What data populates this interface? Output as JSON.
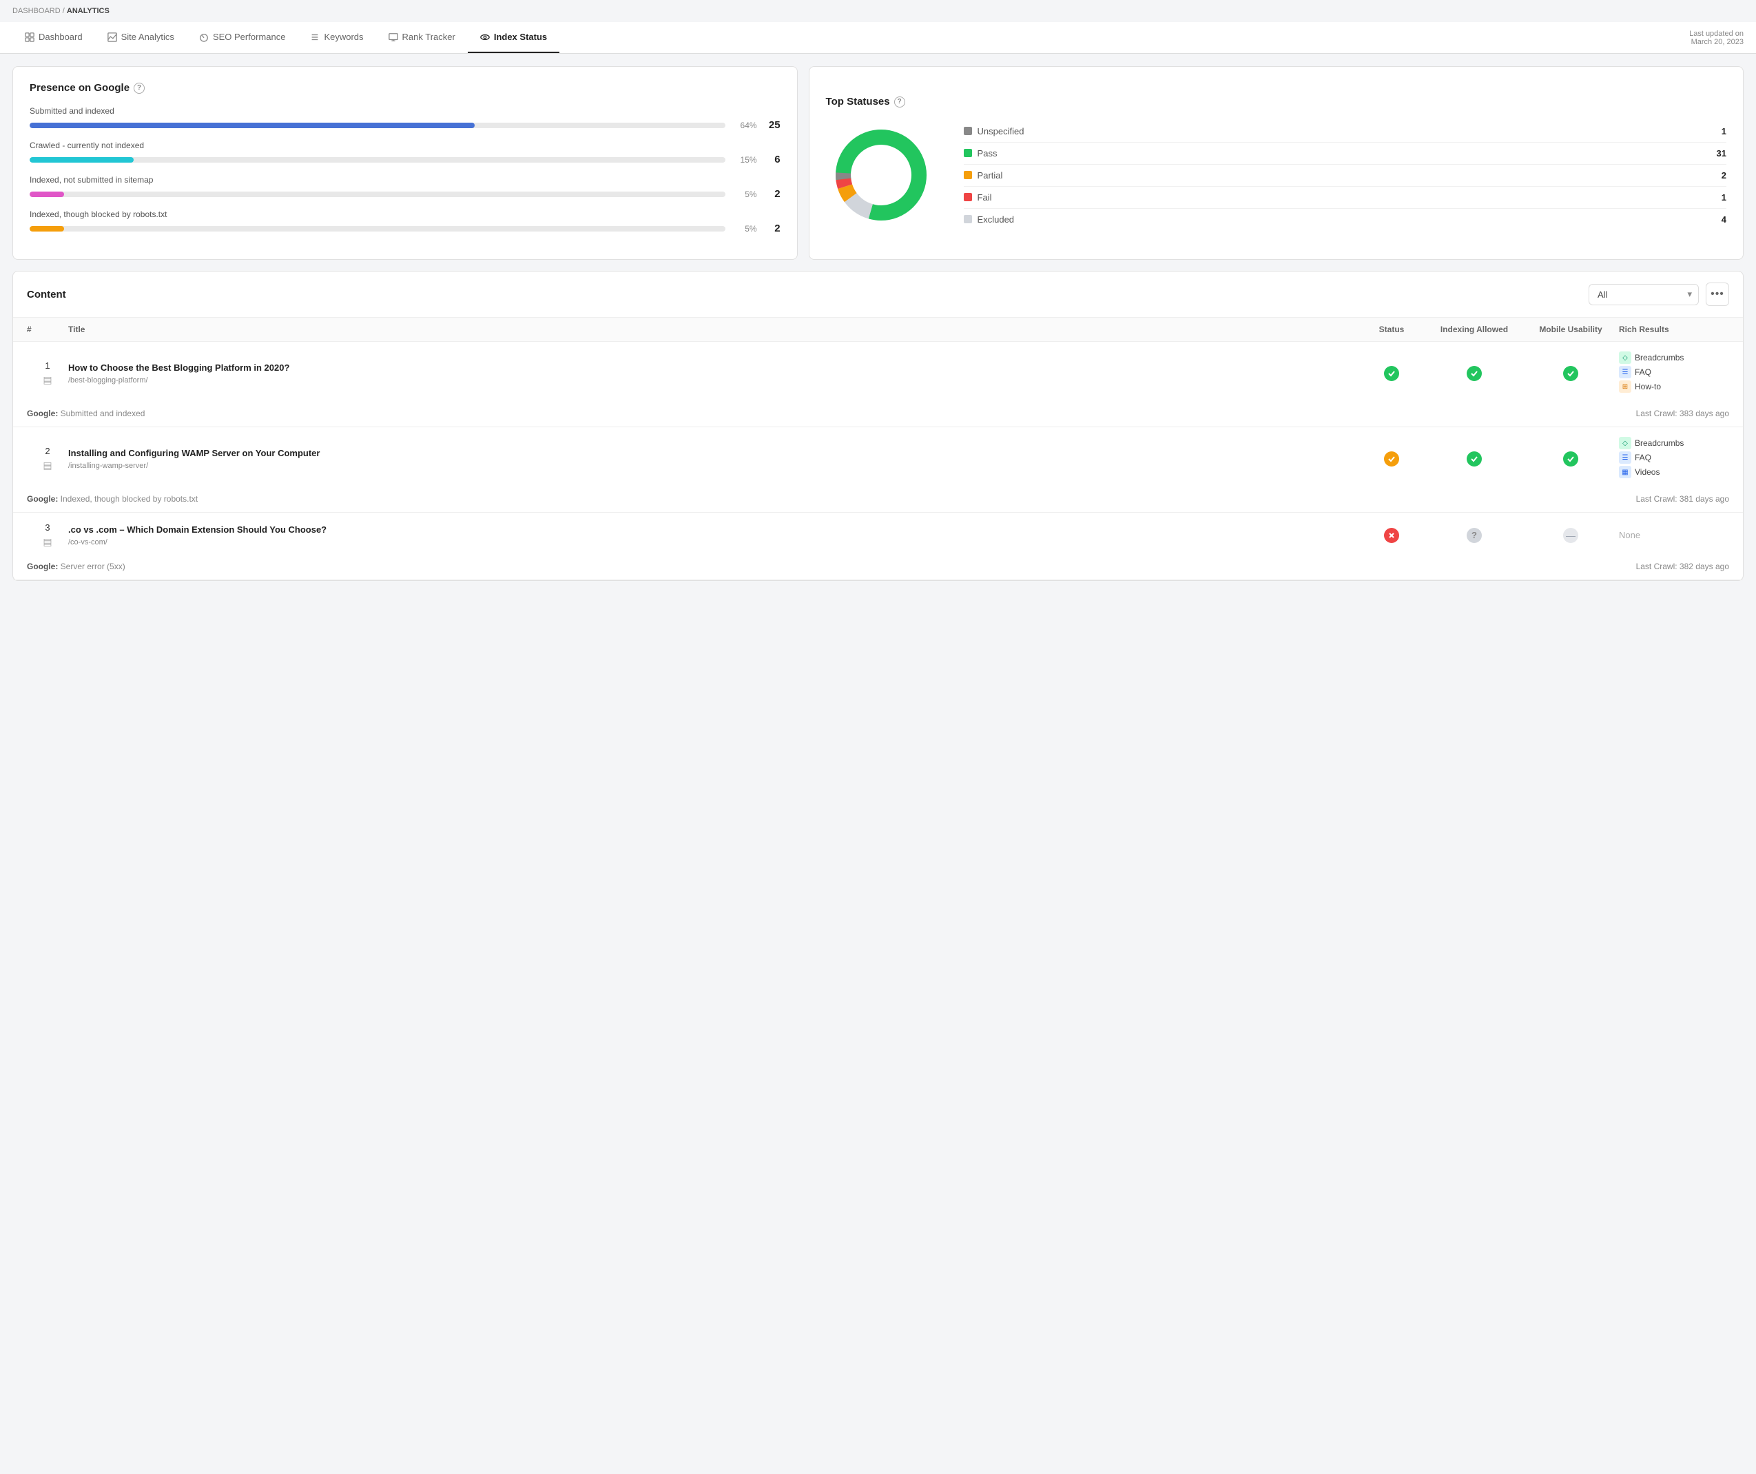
{
  "breadcrumb": {
    "dashboard": "DASHBOARD",
    "separator": "/",
    "current": "ANALYTICS"
  },
  "tabs": [
    {
      "id": "dashboard",
      "label": "Dashboard",
      "icon": "grid"
    },
    {
      "id": "site-analytics",
      "label": "Site Analytics",
      "icon": "chart"
    },
    {
      "id": "seo-performance",
      "label": "SEO Performance",
      "icon": "gauge"
    },
    {
      "id": "keywords",
      "label": "Keywords",
      "icon": "list"
    },
    {
      "id": "rank-tracker",
      "label": "Rank Tracker",
      "icon": "monitor"
    },
    {
      "id": "index-status",
      "label": "Index Status",
      "icon": "eye",
      "active": true
    }
  ],
  "last_updated": "Last updated on\nMarch 20, 2023",
  "presence": {
    "title": "Presence on Google",
    "rows": [
      {
        "label": "Submitted and indexed",
        "pct": 64,
        "pct_label": "64%",
        "count": 25,
        "color": "#4671d5",
        "width": "64"
      },
      {
        "label": "Crawled - currently not indexed",
        "pct": 15,
        "pct_label": "15%",
        "count": 6,
        "color": "#22c6d4",
        "width": "15"
      },
      {
        "label": "Indexed, not submitted in sitemap",
        "pct": 5,
        "pct_label": "5%",
        "count": 2,
        "color": "#e056c7",
        "width": "5"
      },
      {
        "label": "Indexed, though blocked by robots.txt",
        "pct": 5,
        "pct_label": "5%",
        "count": 2,
        "color": "#f59e0b",
        "width": "5"
      }
    ]
  },
  "top_statuses": {
    "title": "Top Statuses",
    "items": [
      {
        "name": "Unspecified",
        "count": 1,
        "color": "#888888"
      },
      {
        "name": "Pass",
        "count": 31,
        "color": "#22c55e"
      },
      {
        "name": "Partial",
        "count": 2,
        "color": "#f59e0b"
      },
      {
        "name": "Fail",
        "count": 1,
        "color": "#ef4444"
      },
      {
        "name": "Excluded",
        "count": 4,
        "color": "#d1d5db"
      }
    ],
    "donut": {
      "pass_pct": 79,
      "excluded_pct": 10,
      "partial_pct": 5,
      "fail_pct": 3,
      "unspecified_pct": 3
    }
  },
  "content": {
    "title": "Content",
    "filter_label": "All",
    "columns": [
      "#",
      "Title",
      "Status",
      "Indexing Allowed",
      "Mobile Usability",
      "Rich Results"
    ],
    "rows": [
      {
        "num": 1,
        "title": "How to Choose the Best Blogging Platform in 2020?",
        "url": "/best-blogging-platform/",
        "status": "green-check",
        "indexing": "green-check",
        "mobile": "green-check",
        "rich_results": [
          "Breadcrumbs",
          "FAQ",
          "How-to"
        ],
        "rich_types": [
          "green",
          "blue",
          "orange"
        ],
        "google_label": "Google:",
        "google_status": "Submitted and indexed",
        "last_crawl": "Last Crawl: 383 days ago"
      },
      {
        "num": 2,
        "title": "Installing and Configuring WAMP Server on Your Computer",
        "url": "/installing-wamp-server/",
        "status": "orange-check",
        "indexing": "green-check",
        "mobile": "green-check",
        "rich_results": [
          "Breadcrumbs",
          "FAQ",
          "Videos"
        ],
        "rich_types": [
          "green",
          "blue",
          "blue"
        ],
        "google_label": "Google:",
        "google_status": "Indexed, though blocked by robots.txt",
        "last_crawl": "Last Crawl: 381 days ago"
      },
      {
        "num": 3,
        "title": ".co vs .com – Which Domain Extension Should You Choose?",
        "url": "/co-vs-com/",
        "status": "red-cross",
        "indexing": "question",
        "mobile": "dash",
        "rich_results": [
          "None"
        ],
        "rich_types": [],
        "google_label": "Google:",
        "google_status": "Server error (5xx)",
        "last_crawl": "Last Crawl: 382 days ago"
      }
    ]
  }
}
